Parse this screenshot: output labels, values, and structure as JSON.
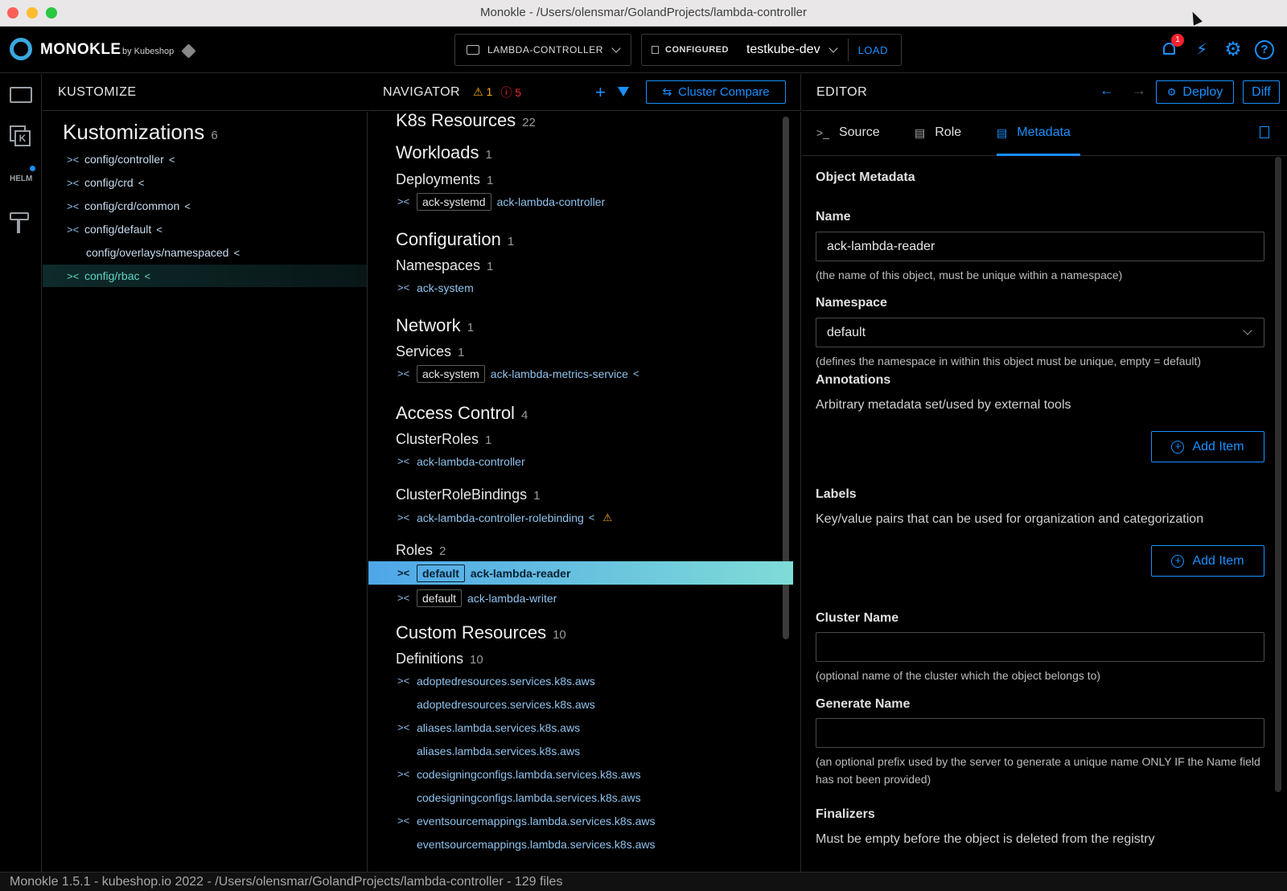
{
  "window": {
    "title": "Monokle - /Users/olensmar/GolandProjects/lambda-controller"
  },
  "header": {
    "logo": "MONOKLE",
    "logo_by": "by Kubeshop",
    "project": "LAMBDA-CONTROLLER",
    "configured_label": "CONFIGURED",
    "context": "testkube-dev",
    "load_label": "LOAD",
    "notification_count": "1"
  },
  "kustomize": {
    "pane_title": "KUSTOMIZE",
    "heading": "Kustomizations",
    "count": "6",
    "items": [
      {
        "label": "config/controller"
      },
      {
        "label": "config/crd"
      },
      {
        "label": "config/crd/common"
      },
      {
        "label": "config/default"
      },
      {
        "label": "config/overlays/namespaced"
      },
      {
        "label": "config/rbac"
      }
    ]
  },
  "navigator": {
    "pane_title": "NAVIGATOR",
    "warnings": "1",
    "errors": "5",
    "cluster_compare_label": "Cluster Compare",
    "k8s": {
      "title": "K8s Resources",
      "count": "22"
    },
    "workloads": {
      "title": "Workloads",
      "count": "1"
    },
    "deployments": {
      "title": "Deployments",
      "count": "1"
    },
    "configuration": {
      "title": "Configuration",
      "count": "1"
    },
    "namespaces": {
      "title": "Namespaces",
      "count": "1"
    },
    "network": {
      "title": "Network",
      "count": "1"
    },
    "services": {
      "title": "Services",
      "count": "1"
    },
    "access_control": {
      "title": "Access Control",
      "count": "4"
    },
    "clusterroles": {
      "title": "ClusterRoles",
      "count": "1"
    },
    "clusterrolebindings": {
      "title": "ClusterRoleBindings",
      "count": "1"
    },
    "roles": {
      "title": "Roles",
      "count": "2"
    },
    "custom_resources": {
      "title": "Custom Resources",
      "count": "10"
    },
    "definitions": {
      "title": "Definitions",
      "count": "10"
    },
    "rows": {
      "deployment": {
        "ns": "ack-systemd",
        "name": "ack-lambda-controller"
      },
      "namespace": {
        "name": "ack-system"
      },
      "service": {
        "ns": "ack-system",
        "name": "ack-lambda-metrics-service"
      },
      "clusterrole": {
        "name": "ack-lambda-controller"
      },
      "clusterrolebinding": {
        "name": "ack-lambda-controller-rolebinding"
      },
      "role1": {
        "ns": "default",
        "name": "ack-lambda-reader"
      },
      "role2": {
        "ns": "default",
        "name": "ack-lambda-writer"
      }
    },
    "definition_rows": [
      "adoptedresources.services.k8s.aws",
      "adoptedresources.services.k8s.aws",
      "aliases.lambda.services.k8s.aws",
      "aliases.lambda.services.k8s.aws",
      "codesigningconfigs.lambda.services.k8s.aws",
      "codesigningconfigs.lambda.services.k8s.aws",
      "eventsourcemappings.lambda.services.k8s.aws",
      "eventsourcemappings.lambda.services.k8s.aws"
    ]
  },
  "editor": {
    "pane_title": "EDITOR",
    "deploy_label": "Deploy",
    "diff_label": "Diff",
    "tabs": [
      "Source",
      "Role",
      "Metadata"
    ],
    "form": {
      "section_title": "Object Metadata",
      "name_label": "Name",
      "name_value": "ack-lambda-reader",
      "name_help": "(the name of this object, must be unique within a namespace)",
      "namespace_label": "Namespace",
      "namespace_value": "default",
      "namespace_help": "(defines the namespace in within this object must be unique, empty = default)",
      "annotations_label": "Annotations",
      "annotations_desc": "Arbitrary metadata set/used by external tools",
      "add_item_label": "Add Item",
      "labels_label": "Labels",
      "labels_desc": "Key/value pairs that can be used for organization and categorization",
      "cluster_name_label": "Cluster Name",
      "cluster_name_help": "(optional name of the cluster which the object belongs to)",
      "generate_name_label": "Generate Name",
      "generate_name_help": "(an optional prefix used by the server to generate a unique name ONLY IF the Name field has not been provided)",
      "finalizers_label": "Finalizers",
      "finalizers_desc": "Must be empty before the object is deleted from the registry"
    }
  },
  "status_bar": {
    "text": "Monokle 1.5.1 - kubeshop.io 2022 - /Users/olensmar/GolandProjects/lambda-controller - 129 files"
  }
}
